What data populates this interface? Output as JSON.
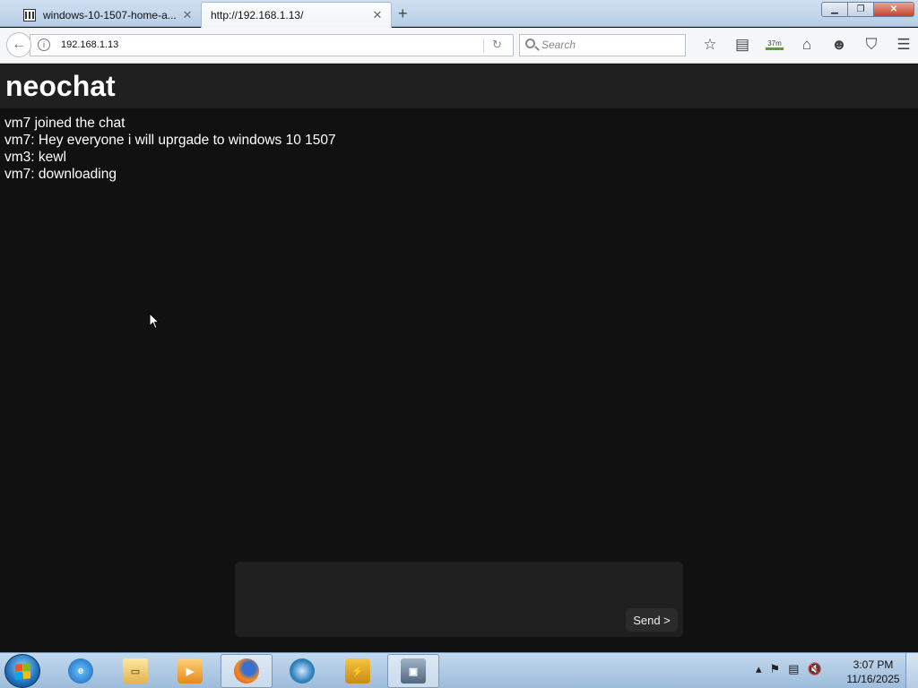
{
  "browser": {
    "tabs": [
      {
        "title": "windows-10-1507-home-a...",
        "active": false
      },
      {
        "title": "http://192.168.1.13/",
        "active": true
      }
    ],
    "url": "192.168.1.13",
    "search_placeholder": "Search",
    "download_badge": "37m",
    "toolbar_icons": [
      "bookmark-star-icon",
      "reading-list-icon",
      "downloads-icon",
      "home-icon",
      "chat-icon",
      "pocket-icon",
      "menu-icon"
    ]
  },
  "page": {
    "title": "neochat",
    "messages": [
      "vm7 joined the chat",
      "vm7: Hey everyone i will uprgade to windows 10 1507",
      "vm3: kewl",
      "vm7: downloading"
    ],
    "composer": {
      "value": "",
      "send_label": "Send >"
    }
  },
  "taskbar": {
    "apps": [
      "internet-explorer",
      "file-explorer",
      "media-player",
      "firefox",
      "network-app",
      "winamp",
      "remote-desktop"
    ],
    "active_app": "firefox",
    "time": "3:07 PM",
    "date": "11/16/2025"
  },
  "colors": {
    "page_bg": "#111111",
    "header_bg": "#202020",
    "text": "#ffffff"
  }
}
